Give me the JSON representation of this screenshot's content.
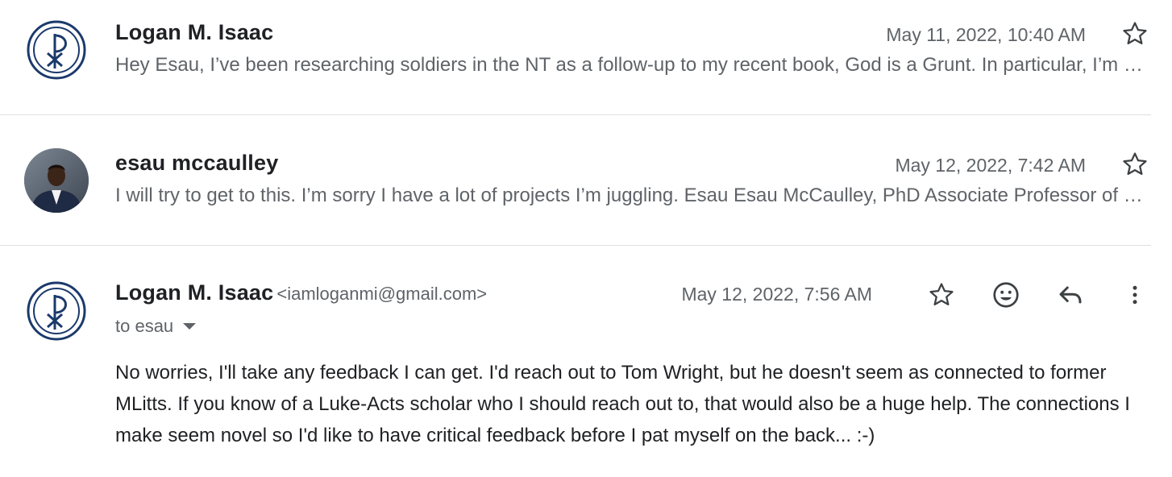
{
  "thread": {
    "messages": [
      {
        "sender": "Logan M. Isaac",
        "date": "May 11, 2022, 10:40 AM",
        "snippet": "Hey Esau, I’ve been researching soldiers in the NT as a follow-up to my recent book, God is a Grunt. In particular, I’m curious about the soldiers in Luke-Acts and whether anyone has written on the subject."
      },
      {
        "sender": "esau mccaulley",
        "date": "May 12, 2022, 7:42 AM",
        "snippet": "I will try to get to this. I’m sorry I have a lot of projects I’m juggling. Esau Esau McCaulley, PhD Associate Professor of New Testament Wheaton College"
      },
      {
        "sender": "Logan M. Isaac",
        "email": "<iamloganmi@gmail.com>",
        "date": "May 12, 2022, 7:56 AM",
        "to": "to esau",
        "body": "No worries, I'll take any feedback I can get. I'd reach out to Tom Wright, but he doesn't seem as connected to former MLitts. If you know of a Luke-Acts scholar who I should reach out to, that would also be a huge help. The connections I make seem novel so I'd like to have critical feedback before I pat myself on the back... :-)"
      }
    ]
  },
  "icons": {
    "star": "star-icon",
    "emoji": "emoji-icon",
    "reply": "reply-icon",
    "more": "more-vert-icon",
    "chi_rho": "chi-rho-logo-icon"
  },
  "colors": {
    "logo_blue": "#1b3a6b",
    "text_primary": "#202124",
    "text_secondary": "#5f6368",
    "divider": "#e0e0e0"
  }
}
